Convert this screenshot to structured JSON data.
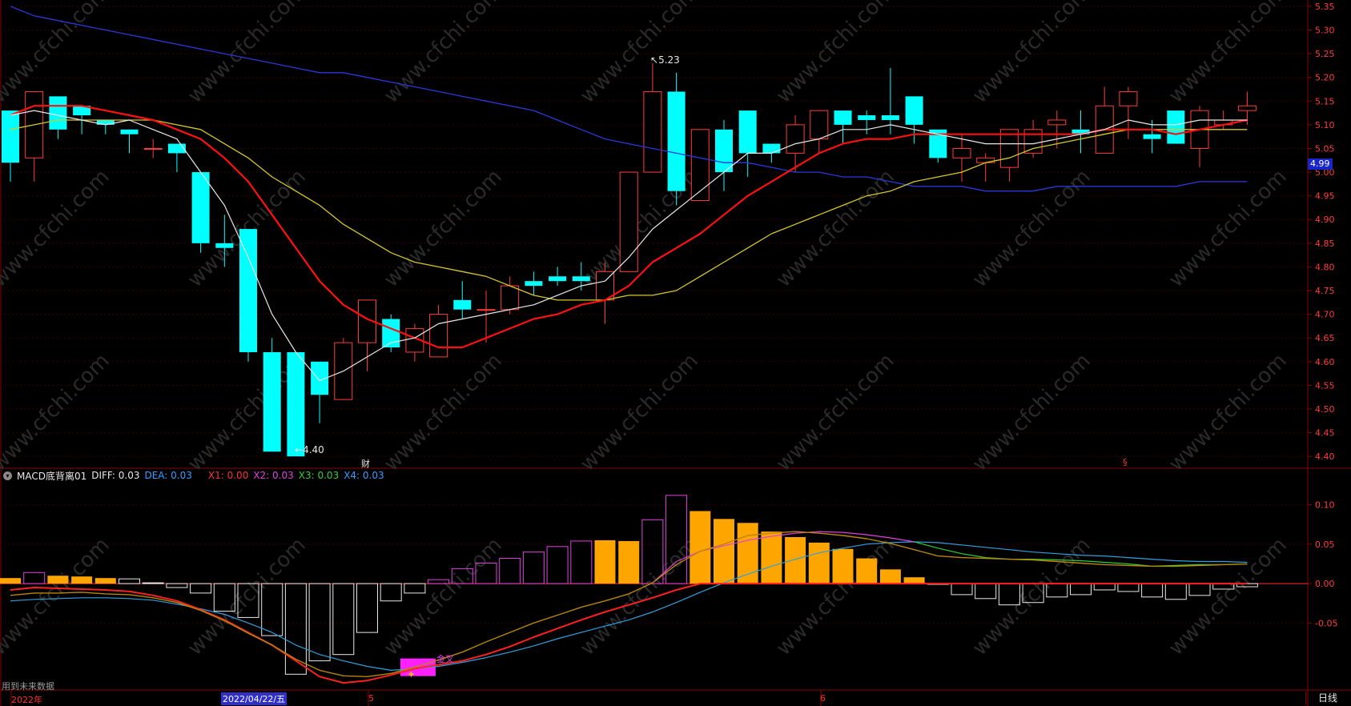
{
  "header": {
    "indicator_name": "MACD底背离01",
    "diff_label": "DIFF: 0.03",
    "dea_label": "DEA: 0.03",
    "x1_label": "X1: 0.00",
    "x2_label": "X2: 0.03",
    "x3_label": "X3: 0.03",
    "x4_label": "X4: 0.03"
  },
  "annotations": {
    "high_label": "5.23",
    "low_label": "4.40",
    "cross_label": "金叉",
    "finance_mark": "财",
    "dividend_mark": "§",
    "future_data_note": "用到未来数据",
    "current_price": "4.99"
  },
  "x_axis": {
    "year_label": "2022年",
    "cursor_date": "2022/04/22/五",
    "month_5": "5",
    "month_6": "6",
    "period_label": "日线"
  },
  "colors": {
    "up": "#ff3c3c",
    "down": "#00ffff",
    "ma_white": "#e8e8e8",
    "ma_red": "#ff1010",
    "ma_yellow": "#d8c828",
    "ma_blue": "#2a38d8",
    "axis_red": "#8a0000",
    "hist_orange": "#ffa500",
    "hist_magenta": "#e040e0",
    "hist_white": "#e8e8e8",
    "label_x1": "#ff3030",
    "label_x2": "#e040e0",
    "label_x3": "#30d030",
    "label_x4": "#30a0ff"
  },
  "chart_data": [
    {
      "type": "candlestick",
      "ylim": [
        4.38,
        5.36
      ],
      "y_ticks": [
        "5.35",
        "5.30",
        "5.25",
        "5.20",
        "5.15",
        "5.10",
        "5.05",
        "5.00",
        "4.95",
        "4.90",
        "4.85",
        "4.80",
        "4.75",
        "4.70",
        "4.65",
        "4.60",
        "4.55",
        "4.50",
        "4.45",
        "4.40"
      ],
      "candles": [
        [
          5.13,
          5.13,
          4.98,
          5.02
        ],
        [
          5.03,
          5.17,
          4.98,
          5.17
        ],
        [
          5.16,
          5.16,
          5.07,
          5.09
        ],
        [
          5.14,
          5.14,
          5.08,
          5.12
        ],
        [
          5.11,
          5.1,
          5.08,
          5.1
        ],
        [
          5.09,
          5.09,
          5.04,
          5.08
        ],
        [
          5.05,
          5.07,
          5.03,
          5.05
        ],
        [
          5.06,
          5.06,
          5.0,
          5.04
        ],
        [
          5.0,
          5.0,
          4.83,
          4.85
        ],
        [
          4.85,
          4.91,
          4.8,
          4.84
        ],
        [
          4.88,
          4.88,
          4.6,
          4.62
        ],
        [
          4.62,
          4.65,
          4.41,
          4.41
        ],
        [
          4.62,
          4.62,
          4.4,
          4.4
        ],
        [
          4.6,
          4.6,
          4.47,
          4.53
        ],
        [
          4.52,
          4.65,
          4.52,
          4.64
        ],
        [
          4.64,
          4.73,
          4.58,
          4.73
        ],
        [
          4.69,
          4.7,
          4.62,
          4.63
        ],
        [
          4.62,
          4.68,
          4.6,
          4.67
        ],
        [
          4.61,
          4.72,
          4.61,
          4.7
        ],
        [
          4.73,
          4.77,
          4.69,
          4.71
        ],
        [
          4.71,
          4.75,
          4.64,
          4.71
        ],
        [
          4.71,
          4.78,
          4.7,
          4.76
        ],
        [
          4.77,
          4.79,
          4.74,
          4.76
        ],
        [
          4.78,
          4.8,
          4.76,
          4.77
        ],
        [
          4.78,
          4.81,
          4.75,
          4.77
        ],
        [
          4.73,
          4.81,
          4.68,
          4.79
        ],
        [
          4.79,
          5.0,
          4.79,
          5.0
        ],
        [
          5.0,
          5.23,
          5.0,
          5.17
        ],
        [
          5.17,
          5.21,
          4.93,
          4.96
        ],
        [
          4.94,
          5.06,
          4.94,
          5.09
        ],
        [
          5.09,
          5.11,
          4.96,
          5.0
        ],
        [
          5.13,
          5.13,
          4.99,
          5.04
        ],
        [
          5.06,
          5.06,
          5.02,
          5.04
        ],
        [
          5.04,
          5.12,
          5.0,
          5.1
        ],
        [
          5.07,
          5.13,
          5.04,
          5.13
        ],
        [
          5.13,
          5.13,
          5.06,
          5.1
        ],
        [
          5.12,
          5.13,
          5.08,
          5.11
        ],
        [
          5.12,
          5.22,
          5.08,
          5.11
        ],
        [
          5.16,
          5.16,
          5.06,
          5.1
        ],
        [
          5.09,
          5.09,
          5.02,
          5.03
        ],
        [
          5.03,
          5.08,
          4.98,
          5.05
        ],
        [
          5.02,
          5.04,
          4.98,
          5.03
        ],
        [
          5.01,
          5.09,
          4.98,
          5.09
        ],
        [
          5.04,
          5.11,
          5.03,
          5.09
        ],
        [
          5.1,
          5.13,
          5.05,
          5.11
        ],
        [
          5.09,
          5.13,
          5.04,
          5.08
        ],
        [
          5.04,
          5.18,
          5.04,
          5.14
        ],
        [
          5.14,
          5.18,
          5.07,
          5.17
        ],
        [
          5.08,
          5.11,
          5.04,
          5.07
        ],
        [
          5.13,
          5.13,
          5.06,
          5.06
        ],
        [
          5.05,
          5.14,
          5.01,
          5.13
        ],
        [
          5.1,
          5.13,
          5.09,
          5.11
        ],
        [
          5.13,
          5.17,
          5.1,
          5.14
        ]
      ],
      "ma_white": [
        5.12,
        5.13,
        5.12,
        5.11,
        5.1,
        5.11,
        5.09,
        5.07,
        5.0,
        4.93,
        4.82,
        4.7,
        4.62,
        4.56,
        4.58,
        4.61,
        4.64,
        4.65,
        4.68,
        4.69,
        4.7,
        4.71,
        4.72,
        4.74,
        4.76,
        4.77,
        4.82,
        4.88,
        4.92,
        4.96,
        5.0,
        5.04,
        5.04,
        5.06,
        5.07,
        5.09,
        5.09,
        5.1,
        5.09,
        5.08,
        5.07,
        5.06,
        5.06,
        5.06,
        5.07,
        5.08,
        5.09,
        5.11,
        5.1,
        5.1,
        5.11,
        5.11,
        5.11
      ],
      "ma_red": [
        5.12,
        5.14,
        5.14,
        5.14,
        5.13,
        5.12,
        5.11,
        5.09,
        5.07,
        5.03,
        4.98,
        4.91,
        4.84,
        4.77,
        4.72,
        4.69,
        4.67,
        4.65,
        4.63,
        4.63,
        4.65,
        4.67,
        4.69,
        4.7,
        4.72,
        4.73,
        4.76,
        4.81,
        4.84,
        4.87,
        4.91,
        4.95,
        4.98,
        5.01,
        5.04,
        5.06,
        5.07,
        5.07,
        5.08,
        5.08,
        5.08,
        5.08,
        5.08,
        5.08,
        5.08,
        5.08,
        5.09,
        5.09,
        5.09,
        5.08,
        5.09,
        5.1,
        5.11
      ],
      "ma_yellow": [
        5.09,
        5.1,
        5.11,
        5.11,
        5.11,
        5.11,
        5.11,
        5.1,
        5.09,
        5.06,
        5.03,
        4.99,
        4.96,
        4.93,
        4.89,
        4.86,
        4.83,
        4.81,
        4.8,
        4.79,
        4.78,
        4.76,
        4.74,
        4.73,
        4.73,
        4.73,
        4.74,
        4.74,
        4.75,
        4.78,
        4.81,
        4.84,
        4.87,
        4.89,
        4.91,
        4.93,
        4.95,
        4.96,
        4.98,
        4.99,
        5.0,
        5.02,
        5.03,
        5.05,
        5.06,
        5.07,
        5.08,
        5.09,
        5.09,
        5.09,
        5.09,
        5.09,
        5.09
      ],
      "ma_blue": [
        5.35,
        5.33,
        5.32,
        5.31,
        5.3,
        5.29,
        5.28,
        5.27,
        5.26,
        5.25,
        5.24,
        5.23,
        5.22,
        5.21,
        5.21,
        5.2,
        5.19,
        5.18,
        5.17,
        5.16,
        5.15,
        5.14,
        5.13,
        5.11,
        5.09,
        5.07,
        5.06,
        5.05,
        5.04,
        5.03,
        5.02,
        5.02,
        5.01,
        5.0,
        5.0,
        4.99,
        4.99,
        4.98,
        4.97,
        4.97,
        4.97,
        4.96,
        4.96,
        4.96,
        4.97,
        4.97,
        4.97,
        4.97,
        4.97,
        4.97,
        4.98,
        4.98,
        4.98
      ],
      "price_ticks_note": "right axis"
    },
    {
      "type": "bar",
      "title": "MACD底背离01",
      "ylim": [
        -0.135,
        0.125
      ],
      "y_ticks": [
        "0.10",
        "0.05",
        "0.00",
        "-0.05"
      ],
      "histogram": [
        0.007,
        0.014,
        0.01,
        0.009,
        0.007,
        0.006,
        0.001,
        -0.005,
        -0.012,
        -0.035,
        -0.043,
        -0.066,
        -0.115,
        -0.098,
        -0.09,
        -0.062,
        -0.022,
        -0.012,
        0.005,
        0.019,
        0.026,
        0.032,
        0.04,
        0.047,
        0.054,
        0.055,
        0.054,
        0.081,
        0.112,
        0.092,
        0.082,
        0.077,
        0.066,
        0.059,
        0.052,
        0.044,
        0.032,
        0.018,
        0.008,
        -0.001,
        -0.014,
        -0.019,
        -0.027,
        -0.024,
        -0.017,
        -0.014,
        -0.008,
        -0.01,
        -0.017,
        -0.02,
        -0.015,
        -0.007,
        -0.004
      ],
      "hist_colors": [
        "orange",
        "magenta",
        "orange",
        "orange",
        "orange",
        "white",
        "white",
        "white",
        "white",
        "white",
        "white",
        "white",
        "white",
        "white",
        "white",
        "white",
        "white",
        "white",
        "magenta",
        "magenta",
        "magenta",
        "magenta",
        "magenta",
        "magenta",
        "magenta",
        "orange",
        "orange",
        "magenta",
        "magenta",
        "orange",
        "orange",
        "orange",
        "orange",
        "orange",
        "orange",
        "orange",
        "orange",
        "orange",
        "orange",
        "white",
        "white",
        "white",
        "white",
        "white",
        "white",
        "white",
        "white",
        "white",
        "white",
        "white",
        "white",
        "white",
        "white"
      ],
      "diff": [
        -0.015,
        -0.012,
        -0.012,
        -0.011,
        -0.013,
        -0.014,
        -0.018,
        -0.024,
        -0.034,
        -0.047,
        -0.063,
        -0.078,
        -0.096,
        -0.11,
        -0.117,
        -0.118,
        -0.114,
        -0.106,
        -0.097,
        -0.087,
        -0.074,
        -0.062,
        -0.05,
        -0.04,
        -0.03,
        -0.022,
        -0.013,
        0.001,
        0.024,
        0.041,
        0.05,
        0.061,
        0.064,
        0.066,
        0.064,
        0.061,
        0.057,
        0.051,
        0.043,
        0.035,
        0.033,
        0.032,
        0.031,
        0.03,
        0.028,
        0.026,
        0.024,
        0.023,
        0.022,
        0.022,
        0.023,
        0.024,
        0.025
      ],
      "dea": [
        -0.022,
        -0.02,
        -0.019,
        -0.018,
        -0.018,
        -0.019,
        -0.021,
        -0.026,
        -0.032,
        -0.039,
        -0.05,
        -0.062,
        -0.078,
        -0.09,
        -0.098,
        -0.105,
        -0.11,
        -0.108,
        -0.105,
        -0.1,
        -0.094,
        -0.087,
        -0.079,
        -0.07,
        -0.062,
        -0.054,
        -0.046,
        -0.036,
        -0.024,
        -0.011,
        0.001,
        0.012,
        0.022,
        0.031,
        0.039,
        0.045,
        0.05,
        0.052,
        0.053,
        0.052,
        0.049,
        0.046,
        0.043,
        0.04,
        0.038,
        0.036,
        0.035,
        0.033,
        0.031,
        0.029,
        0.028,
        0.028,
        0.027
      ],
      "x1": [
        -0.008,
        -0.005,
        -0.006,
        -0.007,
        -0.008,
        -0.01,
        -0.015,
        -0.022,
        -0.033,
        -0.046,
        -0.062,
        -0.078,
        -0.098,
        -0.118,
        -0.126,
        -0.123,
        -0.116,
        -0.108,
        -0.103,
        -0.098,
        -0.09,
        -0.08,
        -0.068,
        -0.057,
        -0.046,
        -0.036,
        -0.027,
        -0.018,
        -0.008,
        0.0,
        0.0,
        0.0,
        0.0,
        0.0,
        0.0,
        0.0,
        0.0,
        0.0,
        0.0,
        0.0,
        0.0,
        0.0,
        0.0,
        0.0,
        0.0,
        0.0,
        0.0,
        0.0,
        0.0,
        0.0,
        0.0,
        0.0,
        0.0
      ],
      "x2": [
        null,
        null,
        null,
        null,
        null,
        null,
        null,
        null,
        null,
        null,
        null,
        null,
        null,
        null,
        null,
        null,
        null,
        null,
        null,
        null,
        null,
        null,
        null,
        null,
        null,
        null,
        null,
        0.001,
        0.028,
        0.041,
        0.048,
        0.055,
        0.06,
        0.064,
        0.066,
        0.065,
        0.062,
        0.058,
        0.053,
        null,
        null,
        null,
        null,
        null,
        null,
        null,
        null,
        null,
        null,
        null,
        null,
        null,
        null
      ],
      "x3": [
        null,
        null,
        null,
        null,
        null,
        null,
        null,
        null,
        null,
        null,
        null,
        null,
        null,
        null,
        null,
        null,
        null,
        null,
        null,
        null,
        null,
        null,
        null,
        null,
        null,
        null,
        null,
        null,
        null,
        null,
        null,
        null,
        null,
        null,
        null,
        null,
        null,
        null,
        0.053,
        0.045,
        0.038,
        0.033,
        0.031,
        0.031,
        0.03,
        0.029,
        0.027,
        0.025,
        0.022,
        0.023,
        0.024,
        0.024,
        0.025
      ]
    }
  ]
}
